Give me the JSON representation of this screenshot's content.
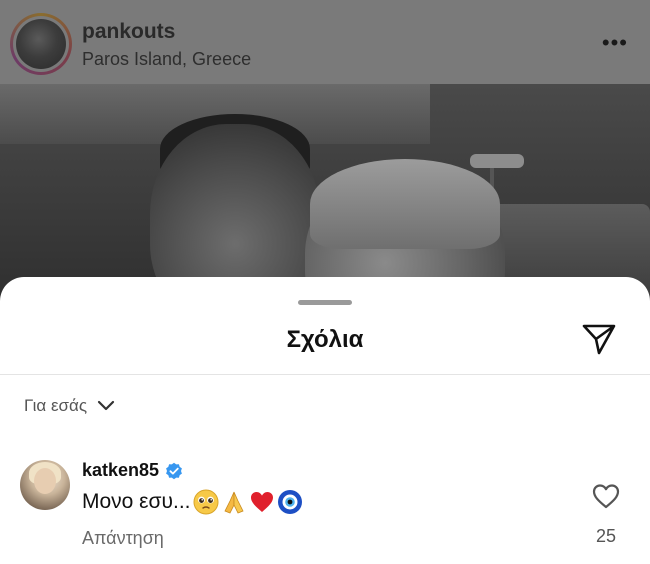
{
  "post": {
    "username": "pankouts",
    "location": "Paros Island, Greece",
    "more_label": "•••"
  },
  "comments_sheet": {
    "title": "Σχόλια",
    "sort_label": "Για εσάς",
    "comments": [
      {
        "username": "katken85",
        "verified": true,
        "text": "Μονο εσυ...",
        "emojis": [
          "pleading-face-emoji",
          "folded-hands-emoji",
          "red-heart-emoji",
          "nazar-amulet-emoji"
        ],
        "reply_label": "Απάντηση",
        "like_count": "25"
      }
    ]
  },
  "colors": {
    "overlay_grey": "#6b6b6b",
    "sheet_bg": "#ffffff",
    "verified_blue": "#3797f0",
    "heart_red": "#e0202c",
    "text_primary": "#111111",
    "text_secondary": "#6a6a6a"
  },
  "icons": {
    "share": "paper-plane-icon",
    "sort": "chevron-down-icon",
    "verified": "verified-badge-icon",
    "like": "heart-outline-icon"
  }
}
